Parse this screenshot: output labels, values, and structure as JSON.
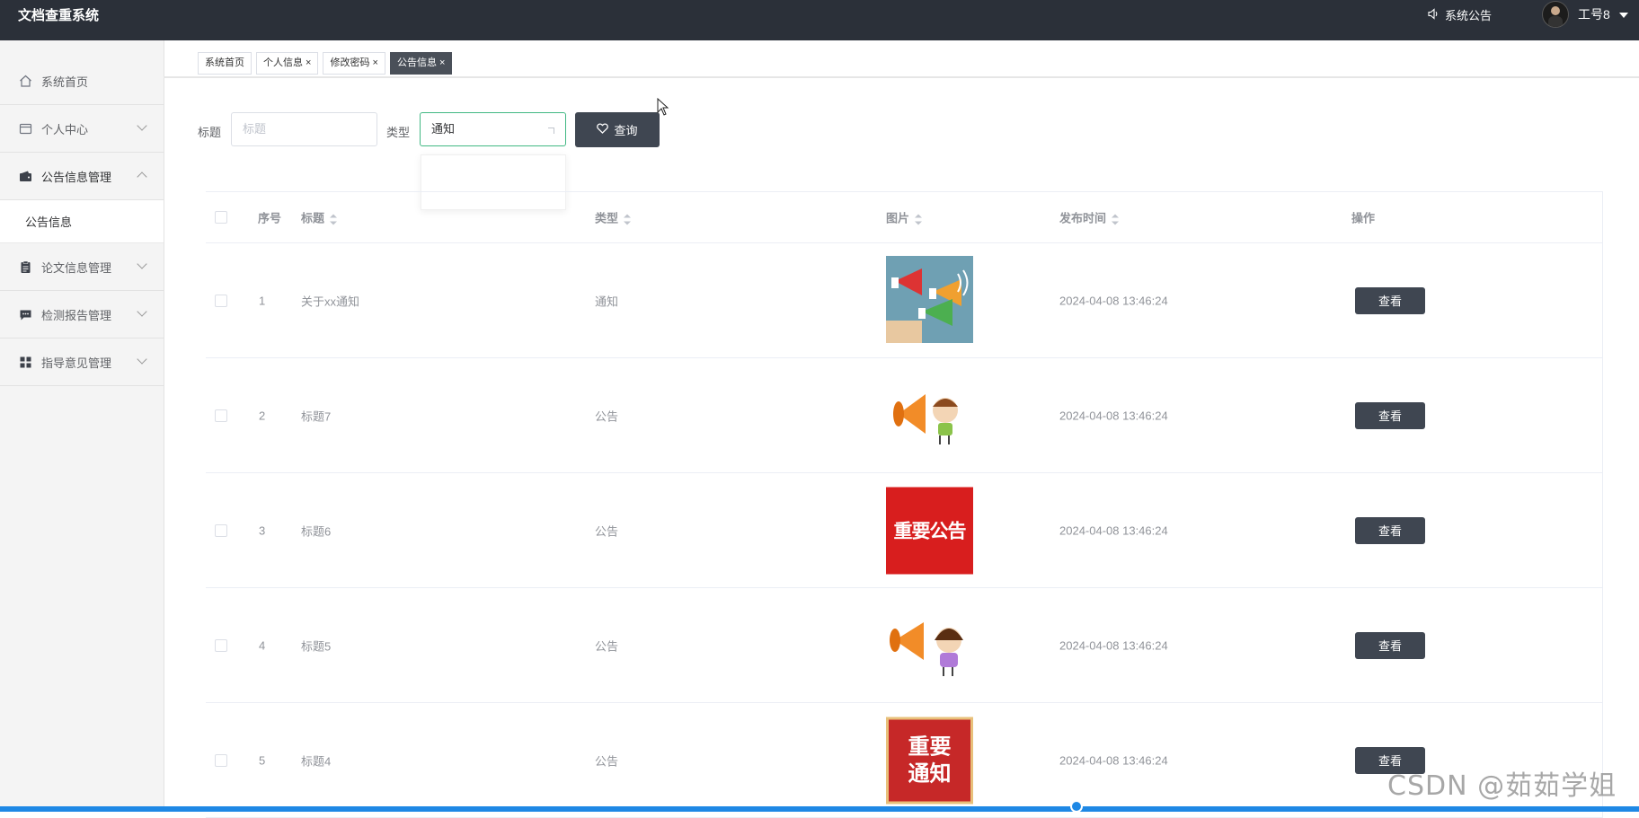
{
  "app": {
    "title": "文档查重系统"
  },
  "header": {
    "announcement": "系统公告",
    "user": "工号8"
  },
  "sidebar": {
    "items": [
      {
        "label": "系统首页",
        "icon": "home-icon",
        "expandable": false
      },
      {
        "label": "个人中心",
        "icon": "card-icon",
        "expandable": true,
        "expanded": false
      },
      {
        "label": "公告信息管理",
        "icon": "wallet-icon",
        "expandable": true,
        "expanded": true
      },
      {
        "label": "论文信息管理",
        "icon": "clipboard-icon",
        "expandable": true,
        "expanded": false
      },
      {
        "label": "检测报告管理",
        "icon": "chat-icon",
        "expandable": true,
        "expanded": false
      },
      {
        "label": "指导意见管理",
        "icon": "grid-icon",
        "expandable": true,
        "expanded": false
      }
    ],
    "submenu": {
      "label": "公告信息"
    }
  },
  "tabs": [
    {
      "label": "系统首页",
      "closable": false,
      "active": false
    },
    {
      "label": "个人信息",
      "closable": true,
      "active": false
    },
    {
      "label": "修改密码",
      "closable": true,
      "active": false
    },
    {
      "label": "公告信息",
      "closable": true,
      "active": true
    }
  ],
  "search": {
    "title_label": "标题",
    "title_placeholder": "标题",
    "type_label": "类型",
    "type_value": "通知",
    "query_label": "查询"
  },
  "table": {
    "headers": {
      "index": "序号",
      "title": "标题",
      "type": "类型",
      "image": "图片",
      "time": "发布时间",
      "action": "操作"
    },
    "rows": [
      {
        "index": "1",
        "title": "关于xx通知",
        "type": "通知",
        "image": "megaphones-image",
        "time": "2024-04-08 13:46:24",
        "action": "查看"
      },
      {
        "index": "2",
        "title": "标题7",
        "type": "公告",
        "image": "kid-megaphone-image",
        "time": "2024-04-08 13:46:24",
        "action": "查看"
      },
      {
        "index": "3",
        "title": "标题6",
        "type": "公告",
        "image": "important-notice-image",
        "image_text": "重要公告",
        "time": "2024-04-08 13:46:24",
        "action": "查看"
      },
      {
        "index": "4",
        "title": "标题5",
        "type": "公告",
        "image": "girl-megaphone-image",
        "time": "2024-04-08 13:46:24",
        "action": "查看"
      },
      {
        "index": "5",
        "title": "标题4",
        "type": "公告",
        "image": "important-notification-image",
        "image_text_1": "重要",
        "image_text_2": "通知",
        "time": "2024-04-08 13:46:24",
        "action": "查看"
      }
    ]
  },
  "watermark": "CSDN @茹茹学姐",
  "colors": {
    "header_bg": "#2b3039",
    "button_bg": "#3f4651",
    "focus_border": "#41b883",
    "scrollbar": "#1e88e5"
  }
}
